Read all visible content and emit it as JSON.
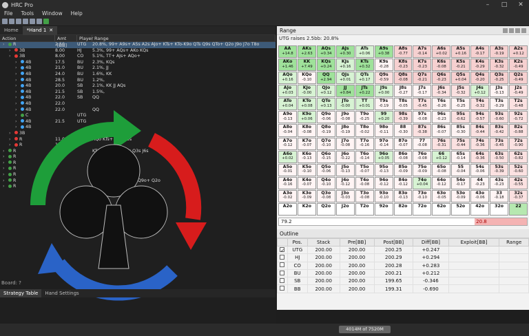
{
  "window": {
    "title": "HRC Pro"
  },
  "menu": [
    "File",
    "Tools",
    "Window",
    "Help"
  ],
  "tabs": {
    "home": "Home",
    "hand": "*Hand 1"
  },
  "strategy": {
    "headers": [
      "Action",
      "Amt [BB]",
      "Player",
      "Range"
    ],
    "rows": [
      {
        "action": "R",
        "amt": "2.50",
        "player": "UTG",
        "range": "20.8%, 99+ A9s+ A5s A2s AJo+ KTs+ KTo-K9o QTs Q9s QTo+ Q2o J9o J7o T8o",
        "color": "#43a047",
        "sel": true,
        "indent": 0
      },
      {
        "action": "3B",
        "amt": "8.00",
        "player": "HJ",
        "range": "5.3%, 99+ AQs+ AKo KQs",
        "color": "#e53935",
        "indent": 1
      },
      {
        "action": "3B",
        "amt": "8.00",
        "player": "CO",
        "range": "5.1%, TT+ AJs+ AQo+",
        "color": "#e53935",
        "indent": 1
      },
      {
        "action": "4B",
        "amt": "17.5",
        "player": "BU",
        "range": "2.3%, KQs",
        "color": "#42a5f5",
        "indent": 2
      },
      {
        "action": "4B",
        "amt": "21.0",
        "player": "BU",
        "range": "2.1%, JJ",
        "color": "#42a5f5",
        "indent": 2
      },
      {
        "action": "4B",
        "amt": "24.0",
        "player": "BU",
        "range": "1.6%, KK",
        "color": "#42a5f5",
        "indent": 2
      },
      {
        "action": "4B",
        "amt": "28.5",
        "player": "BU",
        "range": "1.2%,",
        "color": "#42a5f5",
        "indent": 2
      },
      {
        "action": "4B",
        "amt": "20.0",
        "player": "SB",
        "range": "2.1%, KK JJ AQs",
        "color": "#42a5f5",
        "indent": 2
      },
      {
        "action": "4B",
        "amt": "21.5",
        "player": "SB",
        "range": "1.5%,",
        "color": "#42a5f5",
        "indent": 2
      },
      {
        "action": "4B",
        "amt": "22.0",
        "player": "SB",
        "range": "QQ",
        "color": "#42a5f5",
        "indent": 2
      },
      {
        "action": "4B",
        "amt": "22.0",
        "player": "",
        "range": "",
        "color": "#42a5f5",
        "indent": 2
      },
      {
        "action": "4B",
        "amt": "22.0",
        "player": "",
        "range": "QQ",
        "color": "#42a5f5",
        "indent": 2
      },
      {
        "action": "C",
        "amt": "",
        "player": "UTG",
        "range": "",
        "color": "#43a047",
        "indent": 2
      },
      {
        "action": "4B",
        "amt": "21.5",
        "player": "UTG",
        "range": "",
        "color": "#42a5f5",
        "indent": 2
      },
      {
        "action": "4B",
        "amt": "",
        "player": "",
        "range": "",
        "color": "#42a5f5",
        "indent": 2
      },
      {
        "action": "3B",
        "amt": "",
        "player": "",
        "range": "Qo+ KQs 54s",
        "color": "#e53935",
        "indent": 1
      },
      {
        "action": "R",
        "amt": "11.0",
        "player": "",
        "range": "AQo KTs+ K8s-K5s",
        "color": "#e53935",
        "indent": 1
      },
      {
        "action": "R",
        "amt": "13.5",
        "player": "",
        "range": "",
        "color": "#e53935",
        "indent": 1
      },
      {
        "action": "R",
        "amt": "",
        "player": "",
        "range": "KTo+ QJs Q9s Q5s Q3s J6s",
        "color": "#43a047",
        "indent": 0
      },
      {
        "action": "R",
        "amt": "",
        "player": "",
        "range": "A7o A5o A",
        "color": "#43a047",
        "indent": 0
      },
      {
        "action": "R",
        "amt": "",
        "player": "",
        "range": "A2o K8o K7o",
        "color": "#43a047",
        "indent": 0
      },
      {
        "action": "R",
        "amt": "",
        "player": "",
        "range": "K6s K4s-K2s K4s",
        "color": "#43a047",
        "indent": 0
      },
      {
        "action": "R",
        "amt": "",
        "player": "",
        "range": "K7o+ K8o K3o K9o",
        "color": "#43a047",
        "indent": 0
      },
      {
        "action": "R",
        "amt": "",
        "player": "",
        "range": "K4s-K3s K8o+ Q8s+ Q9o+ Q2o",
        "color": "#43a047",
        "indent": 0
      },
      {
        "action": "R",
        "amt": "",
        "player": "",
        "range": "",
        "color": "#43a047",
        "indent": 0
      }
    ]
  },
  "board": "Board: ?",
  "bottom_tabs": [
    "Strategy Table",
    "Hand Settings"
  ],
  "range_panel": {
    "title": "Range",
    "subtitle": "UTG raises 2.5bb: 20.8%",
    "fold_pct": "79.2",
    "raise_pct": "20.8"
  },
  "grid": [
    [
      [
        "AA",
        "+14.8"
      ],
      [
        "AKs",
        "+2.63"
      ],
      [
        "AQs",
        "+0.34"
      ],
      [
        "AJs",
        "+0.30"
      ],
      [
        "ATs",
        "+0.06"
      ],
      [
        "A9s",
        "+0.38"
      ],
      [
        "A8s",
        "-0.77"
      ],
      [
        "A7s",
        "-0.14"
      ],
      [
        "A6s",
        "+0.02"
      ],
      [
        "A5s",
        "+0.16"
      ],
      [
        "A4s",
        "-0.17"
      ],
      [
        "A3s",
        "-0.19"
      ],
      [
        "A2s",
        "+0.12"
      ]
    ],
    [
      [
        "AKo",
        "+1.46"
      ],
      [
        "KK",
        "+7.49"
      ],
      [
        "KQs",
        "+0.24"
      ],
      [
        "KJs",
        "+0.16"
      ],
      [
        "KTs",
        "+0.32"
      ],
      [
        "K9s",
        "-0.28"
      ],
      [
        "K8s",
        "-0.23"
      ],
      [
        "K7s",
        "-0.23"
      ],
      [
        "K6s",
        "-0.08"
      ],
      [
        "K5s",
        "-0.21"
      ],
      [
        "K4s",
        "-0.29"
      ],
      [
        "K3s",
        "-0.32"
      ],
      [
        "K2s",
        "-0.49"
      ]
    ],
    [
      [
        "AQo",
        "+0.16"
      ],
      [
        "KQo",
        "-0.10"
      ],
      [
        "QQ",
        "+2.94"
      ],
      [
        "QJs",
        "+0.01"
      ],
      [
        "QTs",
        "+0.17"
      ],
      [
        "Q9s",
        "-0.59"
      ],
      [
        "Q8s",
        "-0.08"
      ],
      [
        "Q7s",
        "-0.21"
      ],
      [
        "Q6s",
        "-0.23"
      ],
      [
        "Q5s",
        "+0.04"
      ],
      [
        "Q4s",
        "-0.20"
      ],
      [
        "Q3s",
        "-0.25"
      ],
      [
        "Q2s",
        "-0.49"
      ]
    ],
    [
      [
        "AJo",
        "+0.03"
      ],
      [
        "KJo",
        "-0.00"
      ],
      [
        "QJo",
        "+0.12"
      ],
      [
        "JJ",
        "+0.84"
      ],
      [
        "JTs",
        "+0.22"
      ],
      [
        "J9s",
        "+0.00"
      ],
      [
        "J8s",
        "-0.27"
      ],
      [
        "J7s",
        "-0.17"
      ],
      [
        "J6s",
        "-0.34"
      ],
      [
        "J5s",
        "-0.32"
      ],
      [
        "J4s",
        "+0.12"
      ],
      [
        "J3s",
        "-0.13"
      ],
      [
        "J2s",
        "-0.49"
      ]
    ],
    [
      [
        "ATo",
        "+0.04"
      ],
      [
        "KTo",
        "+0.08"
      ],
      [
        "QTo",
        "+0.13"
      ],
      [
        "JTo",
        "-0.00"
      ],
      [
        "TT",
        "+0.01"
      ],
      [
        "T9s",
        "-0.19"
      ],
      [
        "T8s",
        "-0.05"
      ],
      [
        "T7s",
        "-0.45"
      ],
      [
        "T6s",
        "-0.26"
      ],
      [
        "T5s",
        "-0.25"
      ],
      [
        "T4s",
        "-0.32"
      ],
      [
        "T3s",
        "-0.29"
      ],
      [
        "T2s",
        "-0.48"
      ]
    ],
    [
      [
        "A9o",
        "-0.13"
      ],
      [
        "K9o",
        "+0.06"
      ],
      [
        "Q9o",
        "-0.06"
      ],
      [
        "J9o",
        "-0.08"
      ],
      [
        "T9o",
        "-0.25"
      ],
      [
        "99",
        "+0.20"
      ],
      [
        "98s",
        "-0.39"
      ],
      [
        "97s",
        "-0.08"
      ],
      [
        "96s",
        "-0.23"
      ],
      [
        "95s",
        "-0.62"
      ],
      [
        "94s",
        "-0.57"
      ],
      [
        "93s",
        "-0.60"
      ],
      [
        "92s",
        "-0.72"
      ]
    ],
    [
      [
        "A8o",
        "-0.04"
      ],
      [
        "K8o",
        "-0.08"
      ],
      [
        "Q8o",
        "-0.19"
      ],
      [
        "J8o",
        "-0.19"
      ],
      [
        "T8o",
        "-0.02"
      ],
      [
        "98o",
        "-0.11"
      ],
      [
        "88",
        "-0.30"
      ],
      [
        "87s",
        "-0.38"
      ],
      [
        "86s",
        "-0.07"
      ],
      [
        "85s",
        "-0.30"
      ],
      [
        "84s",
        "-0.44"
      ],
      [
        "83s",
        "-0.42"
      ],
      [
        "82s",
        "-0.88"
      ]
    ],
    [
      [
        "A7o",
        "-0.12"
      ],
      [
        "K7o",
        "-0.07"
      ],
      [
        "Q7o",
        "-0.10"
      ],
      [
        "J7o",
        "-0.08"
      ],
      [
        "T7o",
        "-0.16"
      ],
      [
        "97o",
        "-0.14"
      ],
      [
        "87o",
        "-0.07"
      ],
      [
        "77",
        "-0.08"
      ],
      [
        "76s",
        "-0.31"
      ],
      [
        "75s",
        "-0.44"
      ],
      [
        "74s",
        "-0.36"
      ],
      [
        "73s",
        "-0.45"
      ],
      [
        "72s",
        "-0.90"
      ]
    ],
    [
      [
        "A6o",
        "+0.02"
      ],
      [
        "K6o",
        "-0.13"
      ],
      [
        "Q6o",
        "-0.15"
      ],
      [
        "J6o",
        "-0.22"
      ],
      [
        "T6o",
        "-0.14"
      ],
      [
        "96o",
        "+0.05"
      ],
      [
        "86o",
        "-0.08"
      ],
      [
        "76o",
        "-0.08"
      ],
      [
        "66",
        "+0.12"
      ],
      [
        "65s",
        "-0.14"
      ],
      [
        "64s",
        "-0.36"
      ],
      [
        "63s",
        "-0.50"
      ],
      [
        "62s",
        "-0.82"
      ]
    ],
    [
      [
        "A5o",
        "-0.01"
      ],
      [
        "K5o",
        "-0.10"
      ],
      [
        "Q5o",
        "-0.06"
      ],
      [
        "J5o",
        "-0.13"
      ],
      [
        "T5o",
        "-0.07"
      ],
      [
        "95o",
        "-0.13"
      ],
      [
        "85o",
        "-0.09"
      ],
      [
        "75o",
        "-0.09"
      ],
      [
        "65o",
        "-0.08"
      ],
      [
        "55",
        "-0.04"
      ],
      [
        "54s",
        "-0.06"
      ],
      [
        "53s",
        "-0.39"
      ],
      [
        "52s",
        "-0.60"
      ]
    ],
    [
      [
        "A4o",
        "-0.16"
      ],
      [
        "K4o",
        "-0.07"
      ],
      [
        "Q4o",
        "-0.10"
      ],
      [
        "J4o",
        "-0.12"
      ],
      [
        "T4o",
        "-0.08"
      ],
      [
        "94o",
        "-0.12"
      ],
      [
        "84o",
        "-0.12"
      ],
      [
        "74o",
        "+0.04"
      ],
      [
        "64o",
        "-0.12"
      ],
      [
        "54o",
        "-0.17"
      ],
      [
        "44",
        "-0.23"
      ],
      [
        "43s",
        "-0.23"
      ],
      [
        "42s",
        "-0.55"
      ]
    ],
    [
      [
        "A3o",
        "-0.02"
      ],
      [
        "K3o",
        "-0.09"
      ],
      [
        "Q3o",
        "-0.08"
      ],
      [
        "J3o",
        "-0.03"
      ],
      [
        "T3o",
        "-0.08"
      ],
      [
        "93o",
        "-0.10"
      ],
      [
        "83o",
        "-0.13"
      ],
      [
        "73o",
        "-0.10"
      ],
      [
        "63o",
        "-0.05"
      ],
      [
        "53o",
        "-0.09"
      ],
      [
        "43o",
        "-0.06"
      ],
      [
        "33",
        "-0.18"
      ],
      [
        "32s",
        "-0.37"
      ]
    ],
    [
      [
        "A2o",
        ""
      ],
      [
        "K2o",
        ""
      ],
      [
        "Q2o",
        ""
      ],
      [
        "J2o",
        ""
      ],
      [
        "T2o",
        ""
      ],
      [
        "92o",
        ""
      ],
      [
        "82o",
        ""
      ],
      [
        "72o",
        ""
      ],
      [
        "62o",
        ""
      ],
      [
        "52o",
        ""
      ],
      [
        "42o",
        ""
      ],
      [
        "32o",
        ""
      ],
      [
        "22",
        ""
      ]
    ]
  ],
  "outline": {
    "title": "Outline",
    "headers": [
      "",
      "Pos.",
      "Stack",
      "Pre[BB]",
      "Post[BB]",
      "Diff[BB]",
      "Exploit[BB]",
      "Range"
    ],
    "rows": [
      {
        "checked": true,
        "pos": "UTG",
        "stack": "200.00",
        "pre": "200.00",
        "post": "200.25",
        "diff": "+0.247"
      },
      {
        "checked": false,
        "pos": "HJ",
        "stack": "200.00",
        "pre": "200.00",
        "post": "200.29",
        "diff": "+0.294"
      },
      {
        "checked": false,
        "pos": "CO",
        "stack": "200.00",
        "pre": "200.00",
        "post": "200.28",
        "diff": "+0.283"
      },
      {
        "checked": false,
        "pos": "BU",
        "stack": "200.00",
        "pre": "200.00",
        "post": "200.21",
        "diff": "+0.212"
      },
      {
        "checked": false,
        "pos": "SB",
        "stack": "200.00",
        "pre": "200.00",
        "post": "199.65",
        "diff": "-0.346"
      },
      {
        "checked": false,
        "pos": "BB",
        "stack": "200.00",
        "pre": "200.00",
        "post": "199.31",
        "diff": "-0.690"
      }
    ]
  },
  "memory": "4014M of 7520M"
}
